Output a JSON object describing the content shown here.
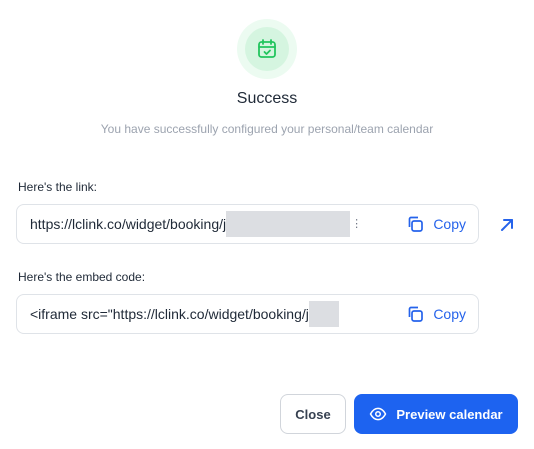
{
  "success": {
    "icon": "calendar-check-icon",
    "title": "Success",
    "subtitle": "You have successfully configured your personal/team calendar"
  },
  "link_section": {
    "label": "Here's the link:",
    "value": "https://lclink.co/widget/booking/j",
    "copy_label": "Copy",
    "open_icon": "arrow-up-right-icon"
  },
  "embed_section": {
    "label": "Here's the embed code:",
    "value": "<iframe src=\"https://lclink.co/widget/booking/j",
    "copy_label": "Copy"
  },
  "footer": {
    "close_label": "Close",
    "preview_label": "Preview calendar",
    "preview_icon": "eye-icon"
  },
  "colors": {
    "accent": "#1d63f0",
    "link": "#2563eb",
    "success_green": "#22c55e",
    "success_bg": "#d5f5e0"
  }
}
